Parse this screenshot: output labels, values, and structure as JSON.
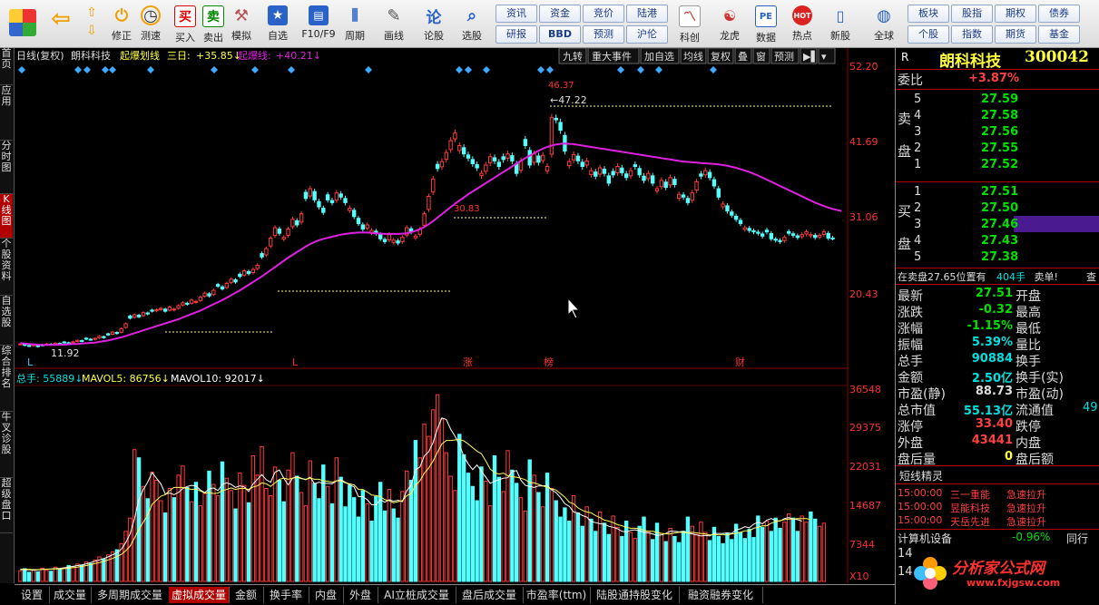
{
  "toolbar": {
    "buttons": [
      {
        "label": "",
        "icon": "app-logo-icon"
      },
      {
        "label": "",
        "icon": "back-icon"
      },
      {
        "label": "修正",
        "icon": "revise-icon"
      },
      {
        "label": "测速",
        "icon": "speed-test-icon"
      },
      {
        "label": "买入",
        "icon": "buy-icon",
        "glyph": "买"
      },
      {
        "label": "卖出",
        "icon": "sell-icon",
        "glyph": "卖"
      },
      {
        "label": "模拟",
        "icon": "simulate-icon"
      },
      {
        "label": "自选",
        "icon": "watchlist-icon"
      },
      {
        "label": "F10/F9",
        "icon": "f10-icon"
      },
      {
        "label": "周期",
        "icon": "period-icon"
      },
      {
        "label": "画线",
        "icon": "draw-line-icon"
      },
      {
        "label": "论股",
        "icon": "discuss-icon"
      },
      {
        "label": "选股",
        "icon": "stock-picker-icon"
      }
    ],
    "grid_buttons": [
      "资讯",
      "资金",
      "竞价",
      "陆港",
      "研报",
      "BBD",
      "预测",
      "沪伦"
    ],
    "buttons2": [
      {
        "label": "科创",
        "icon": "star-market-icon"
      },
      {
        "label": "龙虎",
        "icon": "dragon-tiger-icon"
      },
      {
        "label": "数据",
        "icon": "data-icon",
        "glyph": "PE"
      },
      {
        "label": "热点",
        "icon": "hot-icon",
        "glyph": "HOT"
      },
      {
        "label": "新股",
        "icon": "ipo-icon"
      },
      {
        "label": "全球",
        "icon": "globe-icon"
      }
    ],
    "grid_buttons2": [
      "板块",
      "股指",
      "期权",
      "债券",
      "个股",
      "指数",
      "期货",
      "基金"
    ]
  },
  "left_tabs": [
    "首页",
    "应用",
    "分时图",
    "K线图",
    "个股资料",
    "自选股",
    "综合排名",
    "牛叉诊股",
    "超级盘口"
  ],
  "chart_header": {
    "title": "日线(复权)",
    "stock": "朗科科技",
    "ind1_name": "起爆划线",
    "ind1_item": "三日:",
    "ind1_value": "+35.85↓",
    "ind2_name": "起爆线:",
    "ind2_value": "+40.21↓",
    "tools": [
      "九转",
      "重大事件",
      "加自选",
      "均线",
      "复权",
      "叠",
      "窗",
      "预测"
    ]
  },
  "volume_header": {
    "total": "总手: 55889↓",
    "mavol5": "MAVOL5: 86756↓",
    "mavol10": "MAVOL10: 92017↓"
  },
  "chart_data": {
    "type": "candlestick",
    "y_ticks": [
      "52.20",
      "41.69",
      "31.06",
      "20.43"
    ],
    "ylim": [
      10.5,
      52.2
    ],
    "vol_ticks": [
      "36548",
      "29375",
      "22031",
      "14687",
      "7344"
    ],
    "vol_unit": "X10",
    "annotations": {
      "high": "46.37",
      "high_arrow": "←47.22",
      "low": "11.92",
      "level_mid": "30.83",
      "markers": [
        "L",
        "L",
        "涨",
        "榜",
        "财"
      ]
    },
    "closes": [
      12.3,
      12.1,
      12.0,
      12.2,
      11.92,
      12.1,
      12.3,
      12.2,
      12.4,
      12.3,
      12.5,
      12.4,
      12.6,
      12.8,
      12.7,
      13.0,
      12.9,
      13.1,
      13.4,
      13.2,
      13.6,
      14.0,
      13.8,
      14.5,
      15.2,
      16.0,
      16.5,
      16.2,
      16.8,
      16.6,
      17.0,
      17.2,
      17.4,
      17.0,
      17.6,
      17.3,
      17.8,
      18.2,
      18.0,
      18.6,
      18.4,
      19.0,
      19.6,
      19.2,
      20.0,
      20.6,
      20.2,
      21.0,
      21.6,
      21.2,
      22.0,
      22.8,
      22.4,
      23.0,
      23.6,
      24.8,
      26.0,
      27.5,
      29.0,
      28.2,
      27.6,
      28.8,
      30.2,
      29.4,
      31.0,
      33.2,
      34.6,
      33.0,
      32.0,
      31.2,
      33.0,
      32.6,
      34.0,
      33.4,
      32.6,
      31.8,
      30.6,
      29.6,
      28.8,
      29.4,
      28.6,
      28.2,
      27.4,
      27.0,
      28.0,
      27.2,
      26.8,
      27.6,
      29.0,
      28.4,
      27.8,
      28.8,
      31.0,
      33.5,
      36.0,
      37.5,
      38.5,
      39.8,
      41.5,
      42.6,
      40.8,
      39.6,
      39.0,
      38.2,
      37.6,
      36.8,
      38.0,
      39.2,
      38.6,
      37.8,
      38.8,
      39.6,
      38.6,
      36.8,
      38.6,
      40.8,
      38.0,
      39.6,
      38.4,
      39.4,
      37.8,
      44.8,
      44.5,
      43.0,
      40.0,
      38.5,
      39.5,
      38.6,
      37.8,
      38.6,
      37.2,
      36.4,
      37.6,
      36.8,
      35.4,
      36.6,
      37.8,
      36.9,
      36.2,
      37.2,
      37.8,
      36.6,
      35.8,
      36.8,
      35.4,
      34.6,
      35.8,
      34.8,
      36.2,
      35.2,
      33.8,
      33.4,
      32.6,
      34.0,
      35.6,
      36.4,
      37.2,
      36.2,
      35.0,
      33.4,
      32.4,
      31.4,
      30.8,
      30.2,
      29.6,
      29.0,
      28.6,
      28.4,
      28.2,
      27.8,
      28.4,
      27.4,
      27.2,
      27.0,
      27.6,
      28.2,
      27.9,
      27.6,
      28.0,
      28.4,
      28.0,
      27.6,
      27.9,
      28.4,
      27.5,
      27.51
    ],
    "ma": [
      12.4,
      12.35,
      12.3,
      12.25,
      12.2,
      12.15,
      12.15,
      12.15,
      12.15,
      12.2,
      12.2,
      12.25,
      12.3,
      12.3,
      12.35,
      12.4,
      12.45,
      12.5,
      12.6,
      12.7,
      12.8,
      12.95,
      13.1,
      13.25,
      13.45,
      13.65,
      13.85,
      14.05,
      14.25,
      14.45,
      14.65,
      14.85,
      15.05,
      15.25,
      15.45,
      15.65,
      15.85,
      16.1,
      16.35,
      16.6,
      16.85,
      17.1,
      17.4,
      17.7,
      18.0,
      18.3,
      18.6,
      18.95,
      19.3,
      19.65,
      20.0,
      20.4,
      20.8,
      21.2,
      21.6,
      22.0,
      22.45,
      22.9,
      23.35,
      23.8,
      24.25,
      24.7,
      25.1,
      25.5,
      25.9,
      26.3,
      26.65,
      26.95,
      27.2,
      27.4,
      27.55,
      27.7,
      27.85,
      28.0,
      28.1,
      28.2,
      28.25,
      28.3,
      28.3,
      28.3,
      28.25,
      28.2,
      28.15,
      28.1,
      28.1,
      28.1,
      28.1,
      28.15,
      28.2,
      28.35,
      28.55,
      28.8,
      29.1,
      29.5,
      29.95,
      30.45,
      30.95,
      31.45,
      31.95,
      32.45,
      32.9,
      33.35,
      33.8,
      34.2,
      34.6,
      35.0,
      35.4,
      35.8,
      36.2,
      36.6,
      37.0,
      37.4,
      37.8,
      38.2,
      38.6,
      39.0,
      39.35,
      39.7,
      40.05,
      40.35,
      40.6,
      40.8,
      40.95,
      41.05,
      41.1,
      41.05,
      41.0,
      40.9,
      40.8,
      40.7,
      40.6,
      40.5,
      40.4,
      40.3,
      40.2,
      40.1,
      40.0,
      39.9,
      39.8,
      39.7,
      39.6,
      39.5,
      39.4,
      39.3,
      39.2,
      39.1,
      39.0,
      38.9,
      38.8,
      38.7,
      38.6,
      38.5,
      38.45,
      38.4,
      38.35,
      38.3,
      38.25,
      38.2,
      38.15,
      38.1,
      38.0,
      37.9,
      37.75,
      37.6,
      37.4,
      37.2,
      37.0,
      36.75,
      36.5,
      36.2,
      35.9,
      35.6,
      35.3,
      35.0,
      34.7,
      34.4,
      34.1,
      33.8,
      33.5,
      33.2,
      32.9,
      32.6,
      32.35,
      32.1,
      31.9,
      31.7,
      31.55,
      31.4
    ],
    "volumes": [
      2100,
      2500,
      1800,
      2300,
      1900,
      2600,
      2200,
      2000,
      2800,
      2400,
      2700,
      3100,
      2900,
      3400,
      3200,
      3800,
      3500,
      4200,
      4800,
      4400,
      5200,
      5800,
      6200,
      7400,
      9800,
      12400,
      25800,
      24200,
      18600,
      16200,
      21400,
      19800,
      15800,
      13400,
      18200,
      16400,
      20800,
      22600,
      18400,
      15600,
      19400,
      14800,
      17200,
      21600,
      19000,
      16800,
      23400,
      20200,
      17800,
      14200,
      21200,
      18800,
      15400,
      24600,
      20800,
      26400,
      18200,
      16800,
      22400,
      19800,
      15600,
      21800,
      25200,
      20600,
      17400,
      14800,
      23600,
      19200,
      16200,
      22800,
      18600,
      15200,
      24200,
      20400,
      14600,
      18800,
      16400,
      12600,
      17800,
      15200,
      11800,
      16600,
      19400,
      13800,
      18000,
      14200,
      12400,
      17600,
      21600,
      19800,
      27600,
      24200,
      30800,
      28400,
      33600,
      36548,
      31800,
      25200,
      20600,
      17800,
      28800,
      24800,
      21200,
      18600,
      15800,
      22400,
      19600,
      14800,
      24600,
      20400,
      17600,
      25600,
      21800,
      19200,
      16400,
      13800,
      23800,
      20800,
      17400,
      14600,
      21200,
      18200,
      15800,
      12600,
      14400,
      11800,
      16800,
      13400,
      10800,
      14600,
      12200,
      9800,
      13600,
      11400,
      9200,
      12800,
      10600,
      8800,
      11800,
      9600,
      8400,
      10800,
      12600,
      9800,
      8200,
      11400,
      9400,
      7800,
      10400,
      8800,
      7600,
      9800,
      12600,
      10800,
      9200,
      11600,
      9600,
      8000,
      10600,
      8800,
      7400,
      9400,
      8200,
      11200,
      9600,
      8400,
      10200,
      8600,
      12800,
      10600,
      11800,
      9800,
      12400,
      10400,
      11600,
      13200,
      12400,
      9800,
      12800,
      11600,
      13600,
      12200,
      10800,
      11400
    ],
    "vol_ma5": [
      2300,
      2300,
      2250,
      2200,
      2250,
      2350,
      2400,
      2450,
      2500,
      2550,
      2650,
      2800,
      2950,
      3100,
      3250,
      3450,
      3700,
      3950,
      4200,
      4500,
      4800,
      5200,
      5600,
      6300,
      7600,
      9300,
      12300,
      16000,
      18000,
      19400,
      21300,
      20200,
      19100,
      17100,
      17300,
      17000,
      17400,
      18200,
      18600,
      18800,
      18700,
      17900,
      17400,
      18100,
      18300,
      17800,
      19000,
      19300,
      19000,
      18400,
      18700,
      18500,
      17600,
      19100,
      20000,
      20900,
      19900,
      19400,
      21400,
      21800,
      20200,
      18900,
      20200,
      20500,
      20200,
      19900,
      20400,
      19100,
      19400,
      19200,
      19200,
      19100,
      19700,
      19900,
      19400,
      18900,
      18500,
      16600,
      16600,
      16000,
      15000,
      15000,
      16000,
      15500,
      16000,
      15700,
      15900,
      15600,
      17800,
      18800,
      21900,
      22400,
      24600,
      25400,
      27200,
      29900,
      32000,
      31700,
      29800,
      28400,
      26800,
      24500,
      23000,
      21900,
      22800,
      21600,
      20400,
      19200,
      19600,
      19900,
      20200,
      20300,
      21500,
      21700,
      19800,
      18800,
      18600,
      18400,
      18700,
      18700,
      18800,
      17900,
      17400,
      16400,
      15200,
      14700,
      13600,
      13400,
      12900,
      12600,
      11700,
      11500,
      11300,
      11200,
      10800,
      10600,
      10300,
      9800,
      9700,
      10000,
      10100,
      9900,
      9600,
      9500,
      9300,
      9000,
      9100,
      9400,
      9800,
      9800,
      9700,
      9800,
      9500,
      9300,
      9100,
      8900,
      9000,
      8900,
      9400,
      9400,
      9400,
      9500,
      9400,
      10100,
      10300,
      10700,
      10500,
      11200,
      11600,
      11300,
      12000,
      12300,
      11900,
      11800,
      12300,
      12500,
      12200,
      12100,
      11800
    ],
    "vol_ma10": [
      2400,
      2400,
      2350,
      2300,
      2300,
      2350,
      2400,
      2400,
      2450,
      2450,
      2500,
      2600,
      2700,
      2800,
      2950,
      3100,
      3300,
      3500,
      3700,
      3950,
      4200,
      4500,
      4900,
      5300,
      6000,
      6900,
      8500,
      10200,
      11600,
      13000,
      15100,
      15900,
      16700,
      17000,
      17800,
      18400,
      18400,
      18400,
      18200,
      18000,
      18100,
      17700,
      17300,
      17400,
      17200,
      17300,
      17800,
      18000,
      18300,
      18000,
      18200,
      18200,
      18000,
      18500,
      18700,
      19300,
      19100,
      18600,
      19300,
      20000,
      20200,
      20000,
      20200,
      20400,
      20100,
      20000,
      20200,
      20000,
      20000,
      19700,
      19600,
      19400,
      19700,
      19700,
      19300,
      19100,
      18900,
      18000,
      18000,
      17500,
      16900,
      16800,
      16600,
      16000,
      15800,
      15400,
      15600,
      15800,
      16800,
      17200,
      18800,
      19700,
      21200,
      22200,
      23600,
      25300,
      26900,
      27600,
      27600,
      27700,
      27800,
      27500,
      26900,
      26200,
      25500,
      25000,
      23600,
      22000,
      21300,
      21000,
      21200,
      20700,
      20500,
      20400,
      20200,
      19900,
      19300,
      19300,
      19000,
      18700,
      18400,
      18100,
      17900,
      17200,
      16500,
      15500,
      15200,
      14400,
      13900,
      13600,
      13400,
      12900,
      12500,
      12000,
      11800,
      11500,
      11100,
      10900,
      10600,
      10400,
      10400,
      10300,
      10000,
      9800,
      9800,
      9600,
      9400,
      9300,
      9300,
      9500,
      9600,
      9600,
      9500,
      9600,
      9500,
      9400,
      9300,
      9100,
      9200,
      9100,
      9200,
      9100,
      9300,
      9400,
      9600,
      9900,
      9900,
      10400,
      10600,
      10900,
      10900,
      11400,
      11700,
      11900,
      12100,
      12200,
      12200,
      12300,
      12300,
      12300,
      12100
    ]
  },
  "quote": {
    "r_label": "R",
    "name": "朗科科技",
    "code": "300042",
    "weibi_label": "委比",
    "weibi": "+3.87%",
    "sell_label": [
      "卖",
      "盘"
    ],
    "buy_label": [
      "买",
      "盘"
    ],
    "sells": [
      {
        "n": "5",
        "p": "27.59",
        "v": ""
      },
      {
        "n": "4",
        "p": "27.58",
        "v": ""
      },
      {
        "n": "3",
        "p": "27.56",
        "v": ""
      },
      {
        "n": "2",
        "p": "27.55",
        "v": ""
      },
      {
        "n": "1",
        "p": "27.52",
        "v": ""
      }
    ],
    "buys": [
      {
        "n": "1",
        "p": "27.51",
        "v": ""
      },
      {
        "n": "2",
        "p": "27.50",
        "v": ""
      },
      {
        "n": "3",
        "p": "27.46",
        "v": ""
      },
      {
        "n": "4",
        "p": "27.43",
        "v": ""
      },
      {
        "n": "5",
        "p": "27.38",
        "v": ""
      }
    ],
    "notice_a": "在卖盘27.65位置有",
    "notice_b": "404手",
    "notice_c": "卖单!",
    "notice_d": "查",
    "stats": [
      {
        "l": "最新",
        "v": "27.51",
        "c": "#00e000",
        "r": "开盘"
      },
      {
        "l": "涨跌",
        "v": "-0.32",
        "c": "#00e000",
        "r": "最高"
      },
      {
        "l": "涨幅",
        "v": "-1.15%",
        "c": "#00e000",
        "r": "最低"
      },
      {
        "l": "振幅",
        "v": "5.39%",
        "c": "#00e0e0",
        "r": "量比"
      },
      {
        "l": "总手",
        "v": "90884",
        "c": "#00e0e0",
        "r": "换手"
      },
      {
        "l": "金额",
        "v": "2.50亿",
        "c": "#00e0e0",
        "r": "换手(实)"
      },
      {
        "l": "市盈(静)",
        "v": "88.73",
        "c": "#dddddd",
        "r": "市盈(动)"
      },
      {
        "l": "总市值",
        "v": "55.13亿",
        "c": "#00e0e0",
        "r": "流通值",
        "rv": "49"
      },
      {
        "l": "涨停",
        "v": "33.40",
        "c": "#ff4040",
        "r": "跌停"
      },
      {
        "l": "外盘",
        "v": "43441",
        "c": "#ff4040",
        "r": "内盘"
      },
      {
        "l": "盘后量",
        "v": "0",
        "c": "#ffff40",
        "r": "盘后额"
      }
    ],
    "short_title": "短线精灵",
    "short_items": [
      {
        "t": "15:00:00",
        "n": "三一重能",
        "e": "急速拉升"
      },
      {
        "t": "15:00:00",
        "n": "昱能科技",
        "e": "急速拉升"
      },
      {
        "t": "15:00:00",
        "n": "天岳先进",
        "e": "急速拉升"
      }
    ],
    "sector": "计算机设备",
    "sector_chg": "-0.96%",
    "sector_tail": "同行",
    "bottom_nums": [
      "14",
      "14"
    ],
    "watermark": "分析家公式网",
    "watermark_url": "www.fxjgsw.com"
  },
  "bottom_tabs": [
    "设置",
    "成交量",
    "多周期成交量",
    "虚拟成交量",
    "金额",
    "换手率",
    "内盘",
    "外盘",
    "AI立桩成交量",
    "盘后成交量",
    "市盈率(ttm)",
    "陆股通持股变化",
    "融资融券变化"
  ],
  "colors": {
    "up": "#ff3b3b",
    "down": "#54ffff",
    "ma": "#e020e0",
    "vol_ma5": "#ffffff",
    "vol_ma10": "#ffff60"
  }
}
